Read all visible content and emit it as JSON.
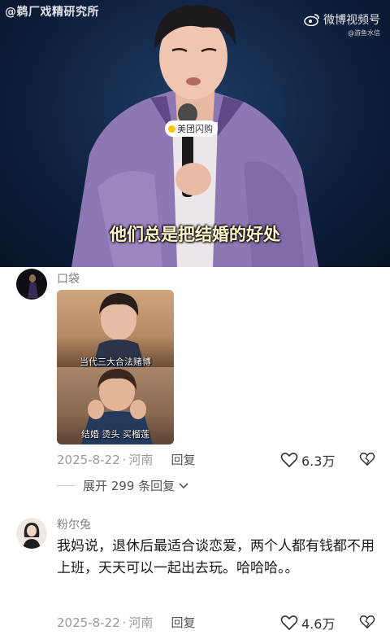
{
  "video": {
    "watermark_left": "@鹈厂戏精研究所",
    "watermark_right": "微博视频号",
    "watermark_right_sub": "@游鱼水信",
    "mic_tag": "美团闪购",
    "caption": "他们总是把结婚的好处"
  },
  "comments": [
    {
      "name": "口袋",
      "image_captions": [
        "当代三大合法赌博",
        "结婚 烫头 买榴莲"
      ],
      "date": "2025-8-22",
      "location": "河南",
      "reply_label": "回复",
      "likes": "6.3万",
      "expand_label": "展开 299 条回复"
    },
    {
      "name": "粉尔兔",
      "text": "我妈说，退休后最适合谈恋爱，两个人都有钱都不用上班，天天可以一起出去玩。哈哈哈。。",
      "date": "2025-8-22",
      "location": "河南",
      "reply_label": "回复",
      "likes": "4.6万"
    }
  ]
}
